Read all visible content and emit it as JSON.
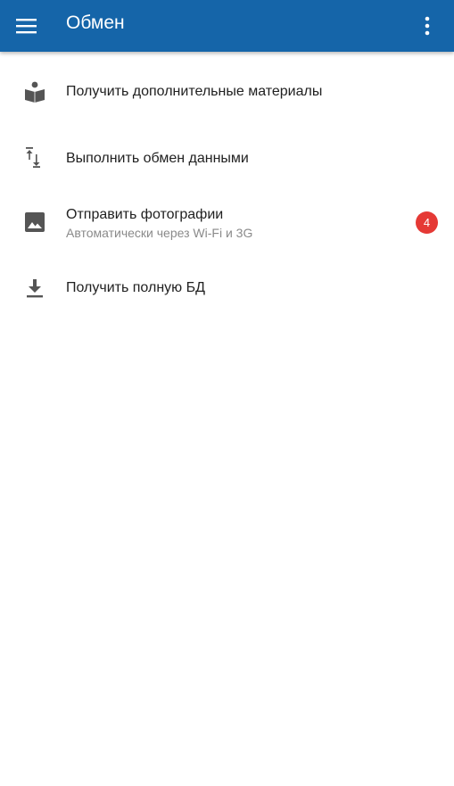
{
  "appbar": {
    "title": "Обмен",
    "menu_icon": "menu-icon",
    "more_icon": "more-vert-icon",
    "background_color": "#1565a9"
  },
  "menu": {
    "items": [
      {
        "icon": "book-reader-icon",
        "label": "Получить дополнительные материалы"
      },
      {
        "icon": "swap-vertical-icon",
        "label": "Выполнить обмен данными"
      },
      {
        "icon": "image-icon",
        "label": "Отправить фотографии",
        "sublabel": "Автоматически через Wi-Fi и 3G",
        "badge": "4",
        "badge_color": "#e53935"
      },
      {
        "icon": "download-icon",
        "label": "Получить полную БД"
      }
    ]
  }
}
